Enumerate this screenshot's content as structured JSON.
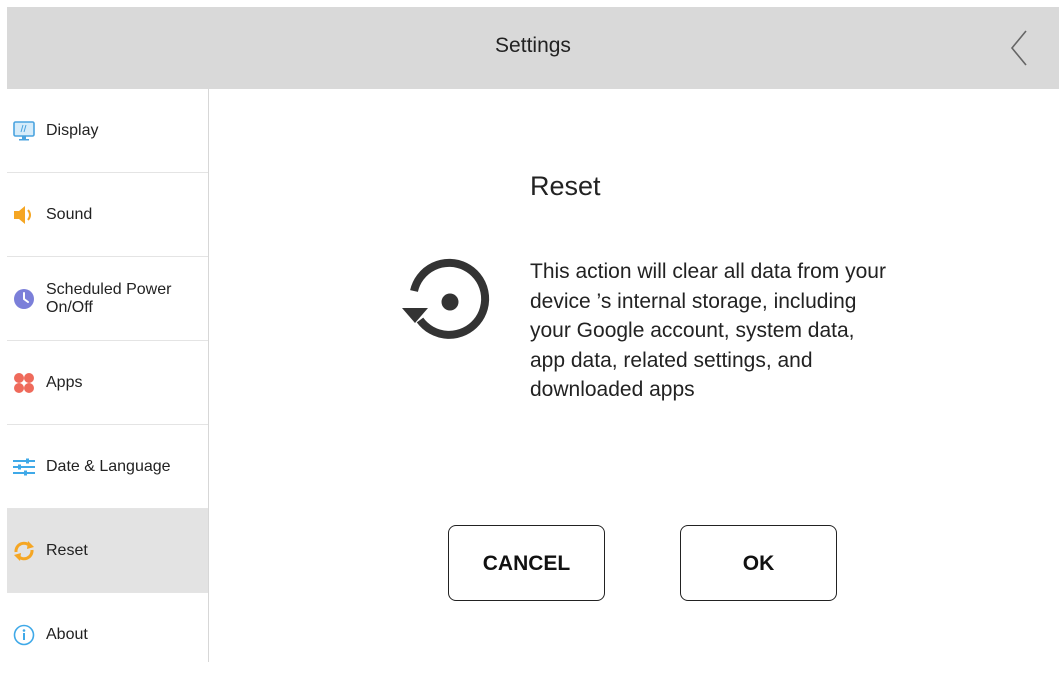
{
  "header": {
    "title": "Settings",
    "back_icon": "chevron-left-icon"
  },
  "sidebar": {
    "items": [
      {
        "label": "Display",
        "icon": "monitor-icon",
        "color": "#4aa3df"
      },
      {
        "label": "Sound",
        "icon": "speaker-icon",
        "color": "#f5a623"
      },
      {
        "label": "Scheduled Power On/Off",
        "icon": "clock-icon",
        "color": "#7b7fd9"
      },
      {
        "label": "Apps",
        "icon": "apps-icon",
        "color": "#ef6a5b"
      },
      {
        "label": "Date & Language",
        "icon": "sliders-icon",
        "color": "#3fa9e8"
      },
      {
        "label": "Reset",
        "icon": "refresh-icon",
        "color": "#f5a623",
        "active": true
      },
      {
        "label": "About",
        "icon": "info-icon",
        "color": "#3fa9e8"
      }
    ]
  },
  "dialog": {
    "title": "Reset",
    "icon": "restore-icon",
    "message": "This action will clear all data from your device ’s internal storage, including your Google account, system data, app data, related settings, and downloaded apps",
    "cancel_label": "CANCEL",
    "ok_label": "OK"
  }
}
